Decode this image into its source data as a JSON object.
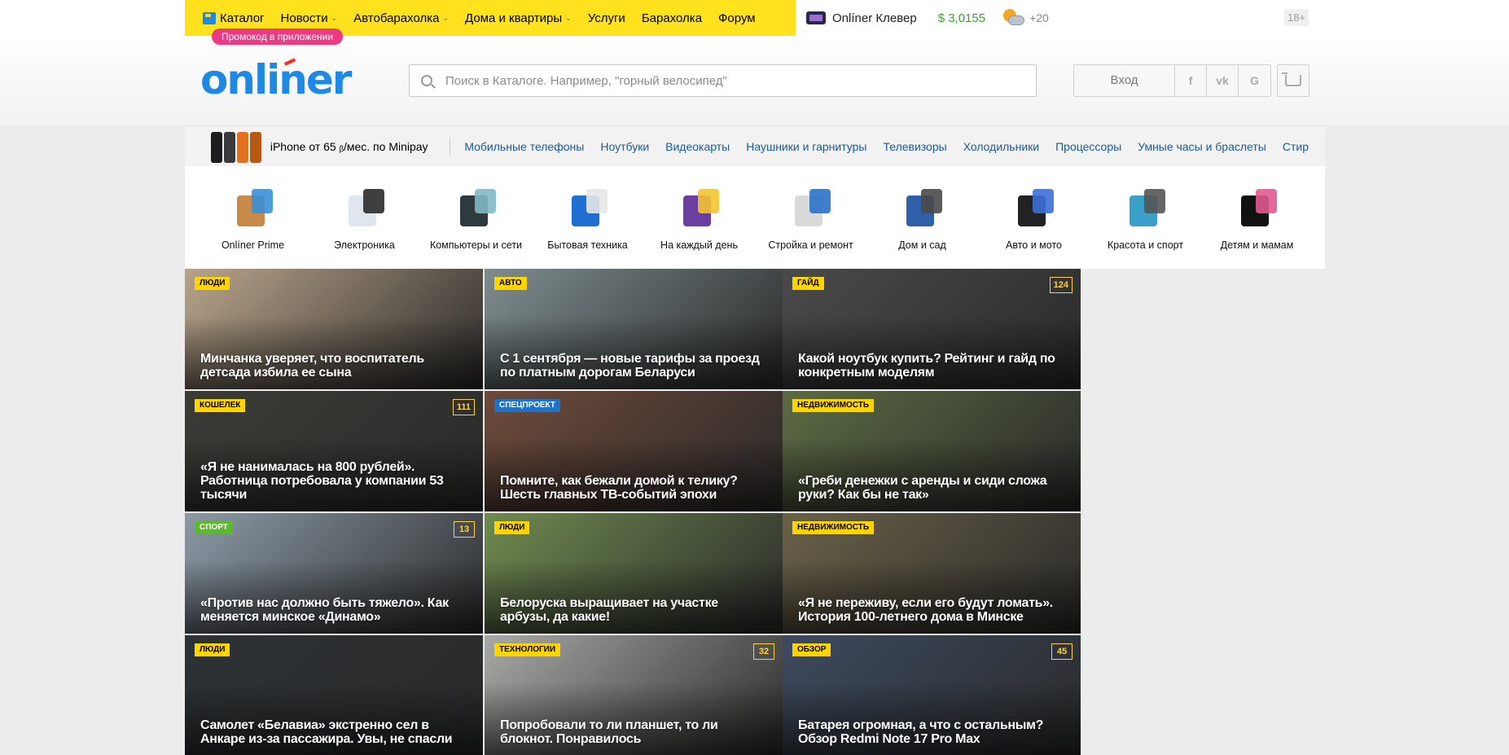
{
  "topbar": {
    "nav": [
      {
        "label": "Каталог",
        "has_icon": true,
        "caret": false
      },
      {
        "label": "Новости",
        "caret": true
      },
      {
        "label": "Автобарахолка",
        "caret": true
      },
      {
        "label": "Дома и квартиры",
        "caret": true
      },
      {
        "label": "Услуги",
        "caret": false
      },
      {
        "label": "Барахолка",
        "caret": false
      },
      {
        "label": "Форум",
        "caret": false
      }
    ],
    "promo_badge": "Промокод в приложении",
    "klever": "Onlíner Клевер",
    "currency": "$ 3,0155",
    "temperature": "+20",
    "age": "18+"
  },
  "header": {
    "logo": "onliner",
    "search_placeholder": "Поиск в Каталоге. Например, \"горный велосипед\"",
    "login": "Вход",
    "social": [
      "f",
      "vk",
      "G"
    ]
  },
  "catnav": {
    "promo": "iPhone от 65 ᵦ/мес. по Minipay",
    "links": [
      "Мобильные телефоны",
      "Ноутбуки",
      "Видеокарты",
      "Наушники и гарнитуры",
      "Телевизоры",
      "Холодильники",
      "Процессоры",
      "Умные часы и браслеты",
      "Стир"
    ]
  },
  "categories": [
    {
      "label": "Onlíner Prime",
      "icon": "box-icon"
    },
    {
      "label": "Электроника",
      "icon": "phone-headphones-icon"
    },
    {
      "label": "Компьютеры и сети",
      "icon": "computer-icon"
    },
    {
      "label": "Бытовая техника",
      "icon": "fridge-icon"
    },
    {
      "label": "На каждый день",
      "icon": "household-icon"
    },
    {
      "label": "Стройка и ремонт",
      "icon": "drill-icon"
    },
    {
      "label": "Дом и сад",
      "icon": "chair-icon"
    },
    {
      "label": "Авто и мото",
      "icon": "tire-icon"
    },
    {
      "label": "Красота и спорт",
      "icon": "bicycle-icon"
    },
    {
      "label": "Детям и мамам",
      "icon": "stroller-icon"
    }
  ],
  "news": [
    {
      "badge": "Люди",
      "badge_color": "#ffd400",
      "title": "Минчанка уверяет, что воспитатель детсада избила ее сына",
      "comments": "",
      "bg": "#b9a48a"
    },
    {
      "badge": "Авто",
      "badge_color": "#ffd400",
      "title": "С 1 сентября — новые тарифы за проезд по платным дорогам Беларуси",
      "comments": "",
      "bg": "#7e8c8e"
    },
    {
      "badge": "Гайд",
      "badge_color": "#ffd400",
      "title": "Какой ноутбук купить? Рейтинг и гайд по конкретным моделям",
      "comments": "124",
      "bg": "#4a4a4a"
    },
    {
      "badge": "Кошелек",
      "badge_color": "#ffd400",
      "title": "«Я не нанималась на 800 рублей». Работница потребовала у компании 53 тысячи",
      "comments": "111",
      "bg": "#3b3b36"
    },
    {
      "badge": "Спецпроект",
      "badge_color": "#1e73c8",
      "title": "Помните, как бежали домой к телику? Шесть главных ТВ-событий эпохи",
      "comments": "",
      "bg": "#6e4a3a"
    },
    {
      "badge": "Недвижимость",
      "badge_color": "#ffd400",
      "title": "«Греби денежки с аренды и сиди сложа руки? Как бы не так»",
      "comments": "",
      "bg": "#5b6b43"
    },
    {
      "badge": "Спорт",
      "badge_color": "#5cb82e",
      "title": "«Против нас должно быть тяжело». Как меняется минское «Динамо»",
      "comments": "13",
      "bg": "#8c9aa6"
    },
    {
      "badge": "Люди",
      "badge_color": "#ffd400",
      "title": "Белоруска выращивает на участке арбузы, да какие!",
      "comments": "",
      "bg": "#6f8a4f"
    },
    {
      "badge": "Недвижимость",
      "badge_color": "#ffd400",
      "title": "«Я не переживу, если его будут ломать». История 100-летнего дома в Минске",
      "comments": "",
      "bg": "#6a6148"
    },
    {
      "badge": "Люди",
      "badge_color": "#ffd400",
      "title": "Самолет «Белавиа» экстренно сел в Анкаре из-за пассажира. Увы, не спасли",
      "comments": "",
      "bg": "#2d3235"
    },
    {
      "badge": "Технологии",
      "badge_color": "#ffd400",
      "title": "Попробовали то ли планшет, то ли блокнот. Понравилось",
      "comments": "32",
      "bg": "#a8a9a6"
    },
    {
      "badge": "Обзор",
      "badge_color": "#ffd400",
      "title": "Батарея огромная, а что с остальным? Обзор Redmi Note 17 Pro Max",
      "comments": "45",
      "bg": "#3d4a5e"
    }
  ]
}
